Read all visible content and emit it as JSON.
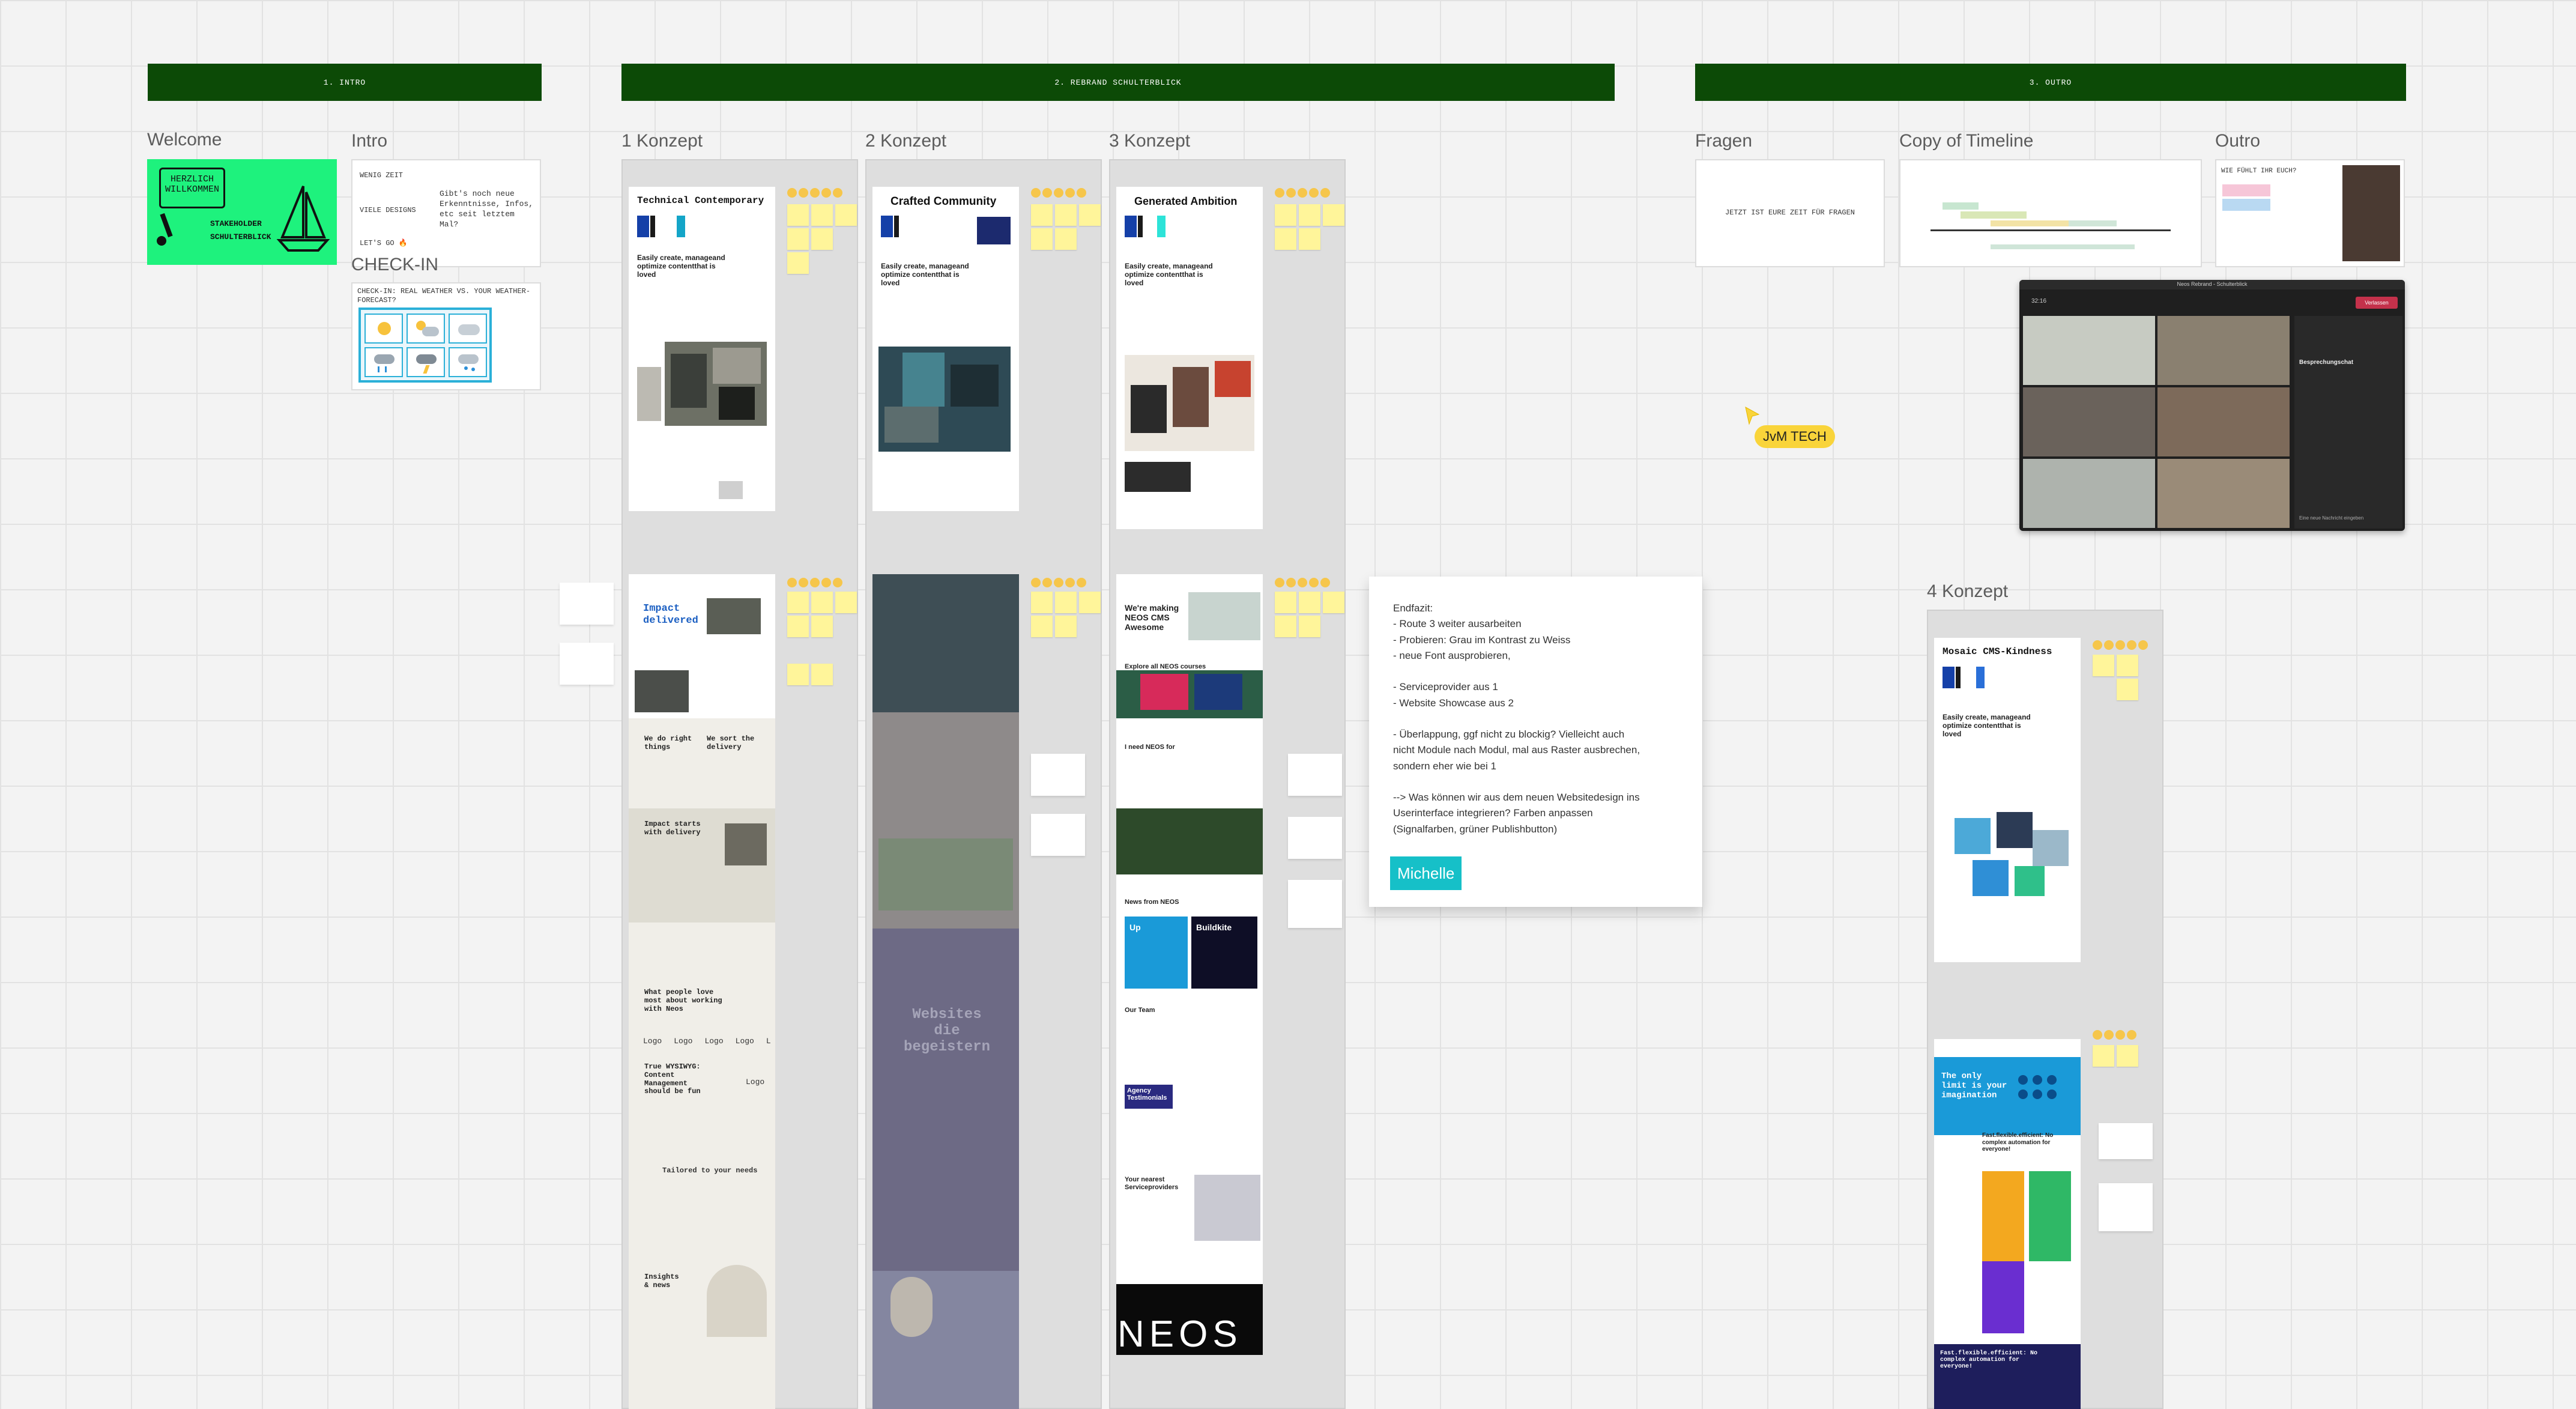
{
  "sections": {
    "intro": "1. INTRO",
    "rebrand": "2. REBRAND SCHULTERBLICK",
    "outro": "3. OUTRO"
  },
  "frames": {
    "welcome": "Welcome",
    "intro": "Intro",
    "concept1": "1 Konzept",
    "concept2": "2 Konzept",
    "concept3": "3 Konzept",
    "fragen": "Fragen",
    "timeline": "Copy of Timeline",
    "outro": "Outro",
    "concept4": "4 Konzept",
    "checkin": "CHECK-IN"
  },
  "welcome_card": {
    "line1": "HERZLICH",
    "line2": "WILLKOMMEN",
    "line3": "STAKEHOLDER",
    "line4": "SCHULTERBLICK"
  },
  "intro_card": {
    "row1_label": "WENIG ZEIT",
    "row2_label": "VIELE DESIGNS",
    "row2_text": "Gibt's noch neue Erkenntnisse, Infos, etc seit letztem Mal?",
    "row3_label": "LET'S GO 🔥"
  },
  "checkin_card": {
    "text": "CHECK-IN: REAL WEATHER VS. YOUR WEATHER-FORECAST?"
  },
  "fragen_card": {
    "text": "JETZT IST EURE ZEIT FÜR FRAGEN"
  },
  "outro_card": {
    "text": "WIE FÜHLT IHR EUCH?"
  },
  "concepts": {
    "c1_title": "Technical Contemporary",
    "c1_tagline": "Easily create, manageand optimize contentthat is loved",
    "c2_title": "Crafted Community",
    "c2_tagline": "Easily create, manageand optimize contentthat is loved",
    "c3_title": "Generated Ambition",
    "c3_tagline": "Easily create, manageand optimize contentthat is loved",
    "c4_title": "Mosaic CMS-Kindness",
    "c4_tagline": "Easily create, manageand optimize contentthat is loved",
    "c1_impact": "Impact delivered",
    "c1_right": "We do right things",
    "c1_sort": "We sort the delivery",
    "c1_starts": "Impact starts with delivery",
    "c1_people": "What people love most about working with Neos",
    "c1_logos": [
      "Logo",
      "Logo",
      "Logo",
      "Logo",
      "L"
    ],
    "c1_true": "True WYSIWYG: Content Management should be fun",
    "c1_logo2": "Logo",
    "c1_tailored": "Tailored to your needs",
    "c1_insights": "Insights & news",
    "c2_overlay": "Websites die begeistern",
    "c3_making": "We're making NEOS CMS Awesome",
    "c3_explore": "Explore all NEOS courses",
    "c3_ineed": "I need NEOS for",
    "c3_news": "News from NEOS",
    "c3_up": "Up",
    "c3_buildkite": "Buildkite",
    "c3_team": "Our Team",
    "c3_agency": "Agency Testimonials",
    "c3_serviceprov": "Your nearest Serviceproviders",
    "c3_neos": "NEOS",
    "c4_only": "The only limit is your imagination",
    "c4_fast": "Fast.flexible.efficient: No complex automation for everyone!",
    "c4_fast2": "Fast.flexible.efficient: No complex automation for everyone!"
  },
  "endfazit": {
    "lines": [
      "Endfazit:",
      "- Route 3 weiter ausarbeiten",
      "- Probieren: Grau im Kontrast zu Weiss",
      "- neue Font ausprobieren,",
      "",
      "- Serviceprovider aus 1",
      "- Website Showcase aus 2",
      "",
      "- Überlappung, ggf nicht zu blockig? Vielleicht auch",
      "nicht Module nach Modul, mal aus Raster ausbrechen,",
      "sondern eher wie bei 1",
      "",
      "--> Was können wir aus dem neuen Websitedesign ins",
      "Userinterface integrieren? Farben anpassen",
      "(Signalfarben, grüner Publishbutton)"
    ],
    "author": "Michelle"
  },
  "cursor": {
    "label": "JvM TECH"
  },
  "video_call": {
    "title": "Neos Rebrand - Schulterblick",
    "time": "32:16",
    "leave": "Verlassen",
    "panel_title": "Besprechungschat",
    "input_placeholder": "Eine neue Nachricht eingeben"
  },
  "colors": {
    "section_header": "#0c4a06",
    "welcome_green": "#1ef27d",
    "teal": "#16c0c8",
    "sticky": "#fff59a",
    "cursor": "#f9d43a"
  }
}
